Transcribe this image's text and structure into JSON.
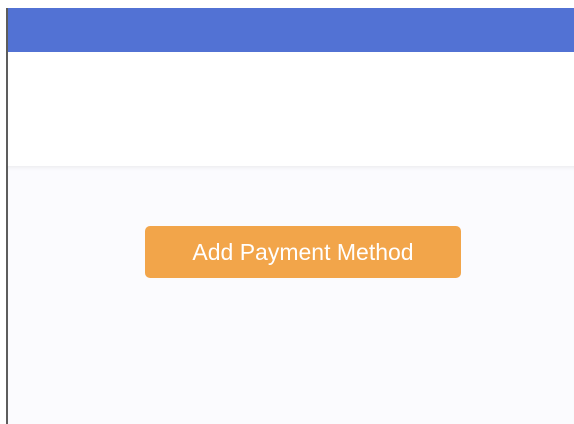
{
  "payment": {
    "add_button_label": "Add Payment Method"
  },
  "colors": {
    "top_bar": "#5272d4",
    "button": "#f2a54a",
    "content_background": "#fbfbfe"
  }
}
